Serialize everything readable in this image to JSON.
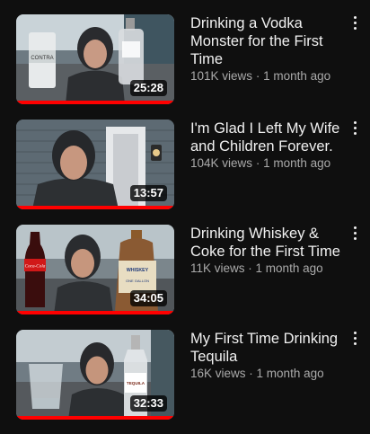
{
  "videos": [
    {
      "title": "Drinking a Vodka Monster for the First Time",
      "views": "101K views",
      "age": "1 month ago",
      "duration": "25:28",
      "watched_fraction": 1.0
    },
    {
      "title": "I'm Glad I Left My Wife and Children Forever.",
      "views": "104K views",
      "age": "1 month ago",
      "duration": "13:57",
      "watched_fraction": 1.0
    },
    {
      "title": "Drinking Whiskey & Coke for the First Time",
      "views": "11K views",
      "age": "1 month ago",
      "duration": "34:05",
      "watched_fraction": 1.0
    },
    {
      "title": "My First Time Drinking Tequila",
      "views": "16K views",
      "age": "1 month ago",
      "duration": "32:33",
      "watched_fraction": 1.0
    }
  ],
  "thumbnail_labels": {
    "can_brand": "CONTRA",
    "jug_label": "WHISKEY",
    "jug_label_sub": "ONE GALLON",
    "cola_brand": "Coca-Cola",
    "tequila_label": "TEQUILA"
  },
  "colors": {
    "background": "#0f0f0f",
    "progress": "#ff0000",
    "meta_text": "#aaaaaa"
  },
  "icons": {
    "more": "more-vert-icon"
  }
}
